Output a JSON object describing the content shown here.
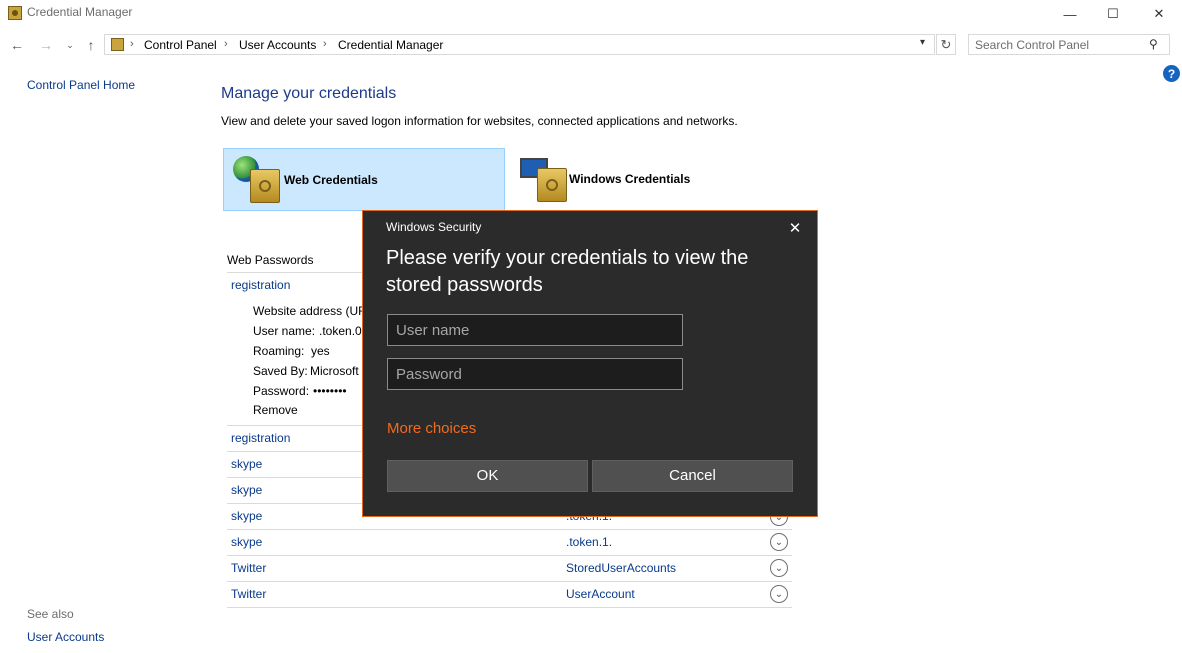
{
  "window": {
    "title": "Credential Manager",
    "minimize_glyph": "—",
    "maximize_glyph": "☐",
    "close_glyph": "✕"
  },
  "address_bar": {
    "crumbs": [
      "Control Panel",
      "User Accounts",
      "Credential Manager"
    ],
    "search_placeholder": "Search Control Panel"
  },
  "left_pane": {
    "home": "Control Panel Home",
    "see_also": "See also",
    "user_accounts": "User Accounts"
  },
  "main": {
    "title": "Manage your credentials",
    "description": "View and delete your saved logon information for websites, connected applications and networks.",
    "web_credentials": "Web Credentials",
    "windows_credentials": "Windows Credentials",
    "web_passwords_header": "Web Passwords",
    "expanded": {
      "name": "registration",
      "website_label": "Website address (URI",
      "user_label": "User name:",
      "user_value": ".token.0",
      "roaming_label": "Roaming:",
      "roaming_value": "yes",
      "saved_by_label": "Saved By:",
      "saved_by_value": "Microsoft",
      "password_label": "Password:",
      "password_value": "••••••••",
      "remove": "Remove"
    },
    "rows": [
      {
        "name": "registration",
        "value": ""
      },
      {
        "name": "skype",
        "value": ""
      },
      {
        "name": "skype",
        "value": ""
      },
      {
        "name": "skype",
        "value": ".token.1."
      },
      {
        "name": "skype",
        "value": ".token.1."
      },
      {
        "name": "Twitter",
        "value": "StoredUserAccounts"
      },
      {
        "name": "Twitter",
        "value": "UserAccount"
      }
    ]
  },
  "dialog": {
    "caption": "Windows Security",
    "heading": "Please verify your credentials to view the stored passwords",
    "username_placeholder": "User name",
    "password_placeholder": "Password",
    "more_choices": "More choices",
    "ok": "OK",
    "cancel": "Cancel"
  },
  "colors": {
    "link": "#0a3a8c",
    "dialog_bg": "#2b2b2b",
    "dialog_accent": "#e06a1c",
    "tile_selected": "#cce8ff"
  }
}
